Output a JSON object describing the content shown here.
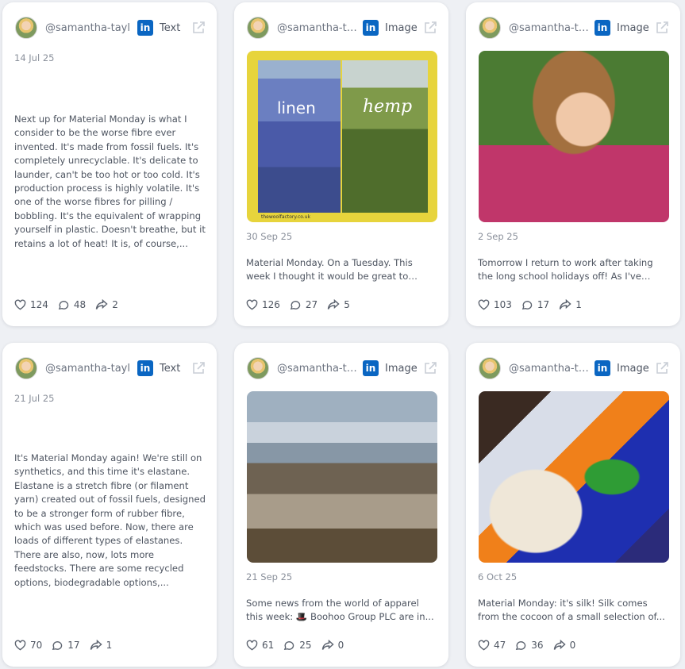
{
  "posts": [
    {
      "username": "@samantha-tayl",
      "platform": "LinkedIn",
      "type": "Text",
      "date": "14 Jul 25",
      "text": "Next up for Material Monday is what I consider to be the worse fibre ever invented. It's made from fossil fuels. It's completely unrecyclable. It's delicate to launder, can't be too hot or too cold. It's production process is highly volatile. It's one of the worse fibres for pilling / bobbling. It's the equivalent of wrapping yourself in plastic. Doesn't breathe, but it retains a lot of heat! It is, of course,...",
      "likes": "124",
      "comments": "48",
      "shares": "2"
    },
    {
      "username": "@samantha-tayl",
      "platform": "LinkedIn",
      "type": "Image",
      "image_labels": [
        "linen",
        "hemp"
      ],
      "image_credit": "thewoolfactory.co.uk",
      "date": "30 Sep 25",
      "text": "Material Monday. On a Tuesday. This week I thought it would be great to give...",
      "likes": "126",
      "comments": "27",
      "shares": "5"
    },
    {
      "username": "@samantha-tayl",
      "platform": "LinkedIn",
      "type": "Image",
      "date": "2 Sep 25",
      "text": "Tomorrow I return to work after taking the long school holidays off! As I've bee...",
      "likes": "103",
      "comments": "17",
      "shares": "1"
    },
    {
      "username": "@samantha-tayl",
      "platform": "LinkedIn",
      "type": "Text",
      "date": "21 Jul 25",
      "text": "It's Material Monday again! We're still on synthetics, and this time it's elastane. Elastane is a stretch fibre (or filament yarn) created out of fossil fuels, designed to be a stronger form of rubber fibre, which was used before. Now, there are loads of different types of elastanes. There are also, now, lots more feedstocks. There are some recycled options, biodegradable options,...",
      "likes": "70",
      "comments": "17",
      "shares": "1"
    },
    {
      "username": "@samantha-tayl",
      "platform": "LinkedIn",
      "type": "Image",
      "date": "21 Sep 25",
      "text": "Some news from the world of apparel this week: 🎩 Boohoo Group PLC are in...",
      "likes": "61",
      "comments": "25",
      "shares": "0"
    },
    {
      "username": "@samantha-tayl",
      "platform": "LinkedIn",
      "type": "Image",
      "date": "6 Oct 25",
      "text": "Material Monday: it's silk! Silk comes from the cocoon of a small selection of...",
      "likes": "47",
      "comments": "36",
      "shares": "0"
    }
  ],
  "colors": {
    "background": "#eef0f4",
    "card": "#ffffff",
    "linkedin": "#0a66c2",
    "text": "#4e5561",
    "muted": "#8a909b"
  },
  "icons": {
    "platform": "linkedin-icon",
    "open": "external-link-icon",
    "likes": "heart-icon",
    "comments": "comment-icon",
    "shares": "share-icon"
  }
}
